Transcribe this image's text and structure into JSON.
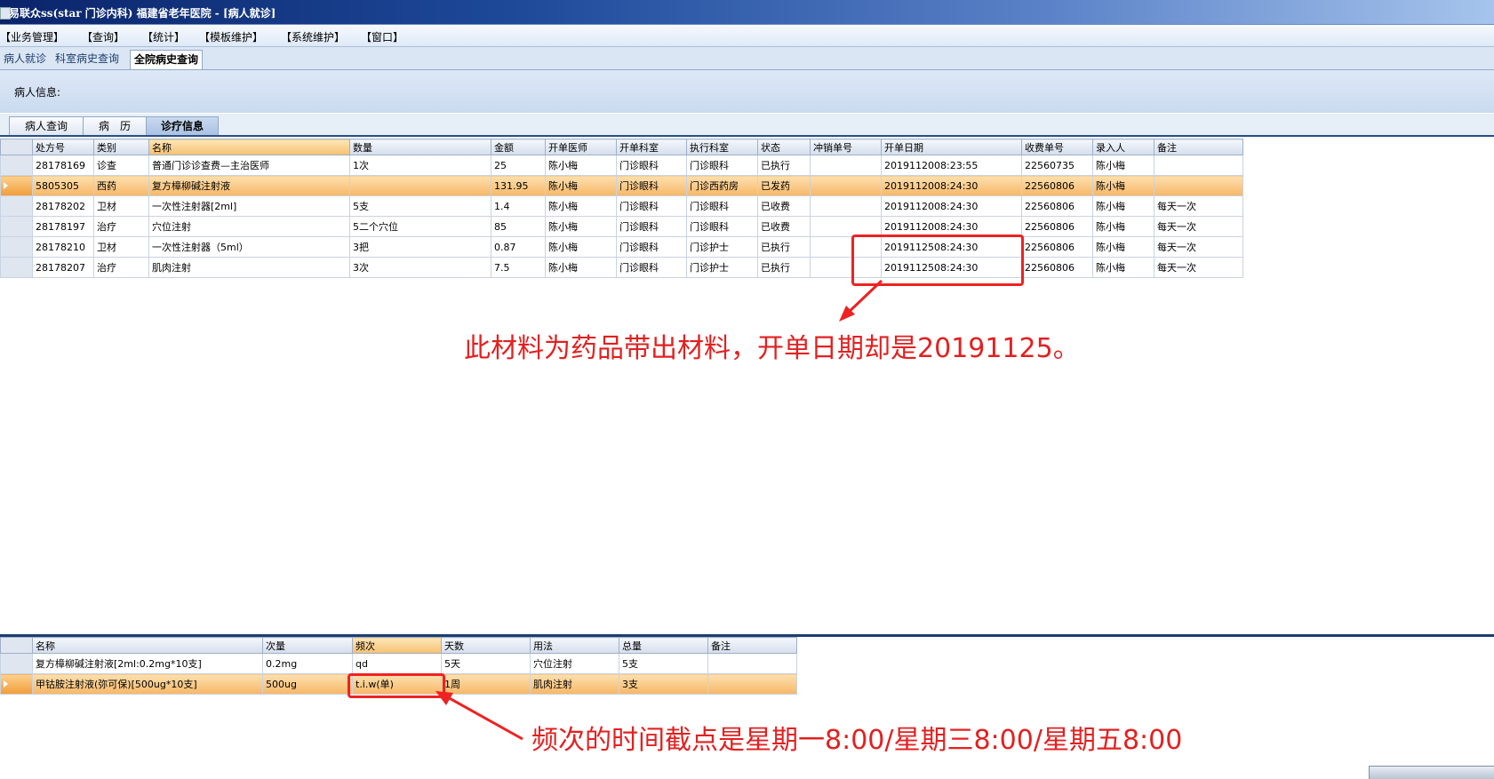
{
  "window": {
    "title": "易联众ss(star 门诊内科) 福建省老年医院 - [病人就诊]"
  },
  "menu": [
    "【业务管理】",
    "【查询】",
    "【统计】",
    "【模板维护】",
    "【系统维护】",
    "【窗口】"
  ],
  "top_tabs": [
    {
      "label": "病人就诊",
      "active": false
    },
    {
      "label": "科室病史查询",
      "active": false
    },
    {
      "label": "全院病史查询",
      "active": true
    }
  ],
  "patient_info_label": "病人信息:",
  "sub_tabs": [
    {
      "label": "病人查询",
      "active": false
    },
    {
      "label": "病　历",
      "active": false
    },
    {
      "label": "诊疗信息",
      "active": true
    }
  ],
  "main_grid": {
    "columns": [
      "处方号",
      "类别",
      "名称",
      "数量",
      "金额",
      "开单医师",
      "开单科室",
      "执行科室",
      "状态",
      "冲销单号",
      "开单日期",
      "收费单号",
      "录入人",
      "备注"
    ],
    "sorted_column": 2,
    "selected_row": 1,
    "rows": [
      [
        "28178169",
        "诊查",
        "普通门诊诊查费—主治医师",
        "1次",
        "25",
        "陈小梅",
        "门诊眼科",
        "门诊眼科",
        "已执行",
        "",
        "2019112008:23:55",
        "22560735",
        "陈小梅",
        ""
      ],
      [
        "5805305",
        "西药",
        "复方樟柳碱注射液",
        "",
        "131.95",
        "陈小梅",
        "门诊眼科",
        "门诊西药房",
        "已发药",
        "",
        "2019112008:24:30",
        "22560806",
        "陈小梅",
        ""
      ],
      [
        "28178202",
        "卫材",
        "一次性注射器[2ml]",
        "5支",
        "1.4",
        "陈小梅",
        "门诊眼科",
        "门诊眼科",
        "已收费",
        "",
        "2019112008:24:30",
        "22560806",
        "陈小梅",
        "每天一次"
      ],
      [
        "28178197",
        "治疗",
        "穴位注射",
        "5二个穴位",
        "85",
        "陈小梅",
        "门诊眼科",
        "门诊眼科",
        "已收费",
        "",
        "2019112008:24:30",
        "22560806",
        "陈小梅",
        "每天一次"
      ],
      [
        "28178210",
        "卫材",
        "一次性注射器（5ml）",
        "3把",
        "0.87",
        "陈小梅",
        "门诊眼科",
        "门诊护士",
        "已执行",
        "",
        "2019112508:24:30",
        "22560806",
        "陈小梅",
        "每天一次"
      ],
      [
        "28178207",
        "治疗",
        "肌肉注射",
        "3次",
        "7.5",
        "陈小梅",
        "门诊眼科",
        "门诊护士",
        "已执行",
        "",
        "2019112508:24:30",
        "22560806",
        "陈小梅",
        "每天一次"
      ]
    ]
  },
  "detail_grid": {
    "columns": [
      "名称",
      "次量",
      "频次",
      "天数",
      "用法",
      "总量",
      "备注"
    ],
    "sorted_column": 2,
    "selected_row": 1,
    "rows": [
      [
        "复方樟柳碱注射液[2ml:0.2mg*10支]",
        "0.2mg",
        "qd",
        "5天",
        "穴位注射",
        "5支",
        ""
      ],
      [
        "甲钴胺注射液(弥可保)[500ug*10支]",
        "500ug",
        "t.i.w(单)",
        "1周",
        "肌肉注射",
        "3支",
        ""
      ]
    ]
  },
  "annotations": {
    "note1": "此材料为药品带出材料，开单日期却是20191125。",
    "note2": "频次的时间截点是星期一8:00/星期三8:00/星期五8:00",
    "color": "#e32020"
  }
}
